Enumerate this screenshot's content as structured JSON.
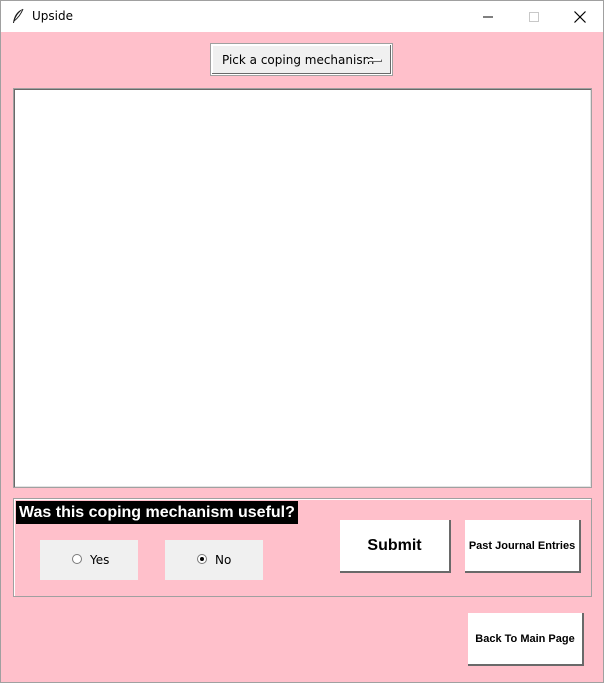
{
  "window": {
    "title": "Upside",
    "controls": {
      "minimize": "minimize-icon",
      "maximize": "maximize-icon",
      "close": "close-icon"
    },
    "icon": "feather-icon"
  },
  "coping_select": {
    "selected": "Pick a coping mechanism"
  },
  "journal": {
    "text": ""
  },
  "feedback": {
    "question": "Was this coping mechanism useful?",
    "options": [
      {
        "label": "Yes",
        "selected": false
      },
      {
        "label": "No",
        "selected": true
      }
    ]
  },
  "buttons": {
    "submit": "Submit",
    "past_entries": "Past Journal Entries",
    "back": "Back To Main Page"
  },
  "colors": {
    "background": "#ffc0cb",
    "question_bg": "#000000",
    "question_fg": "#ffffff"
  }
}
